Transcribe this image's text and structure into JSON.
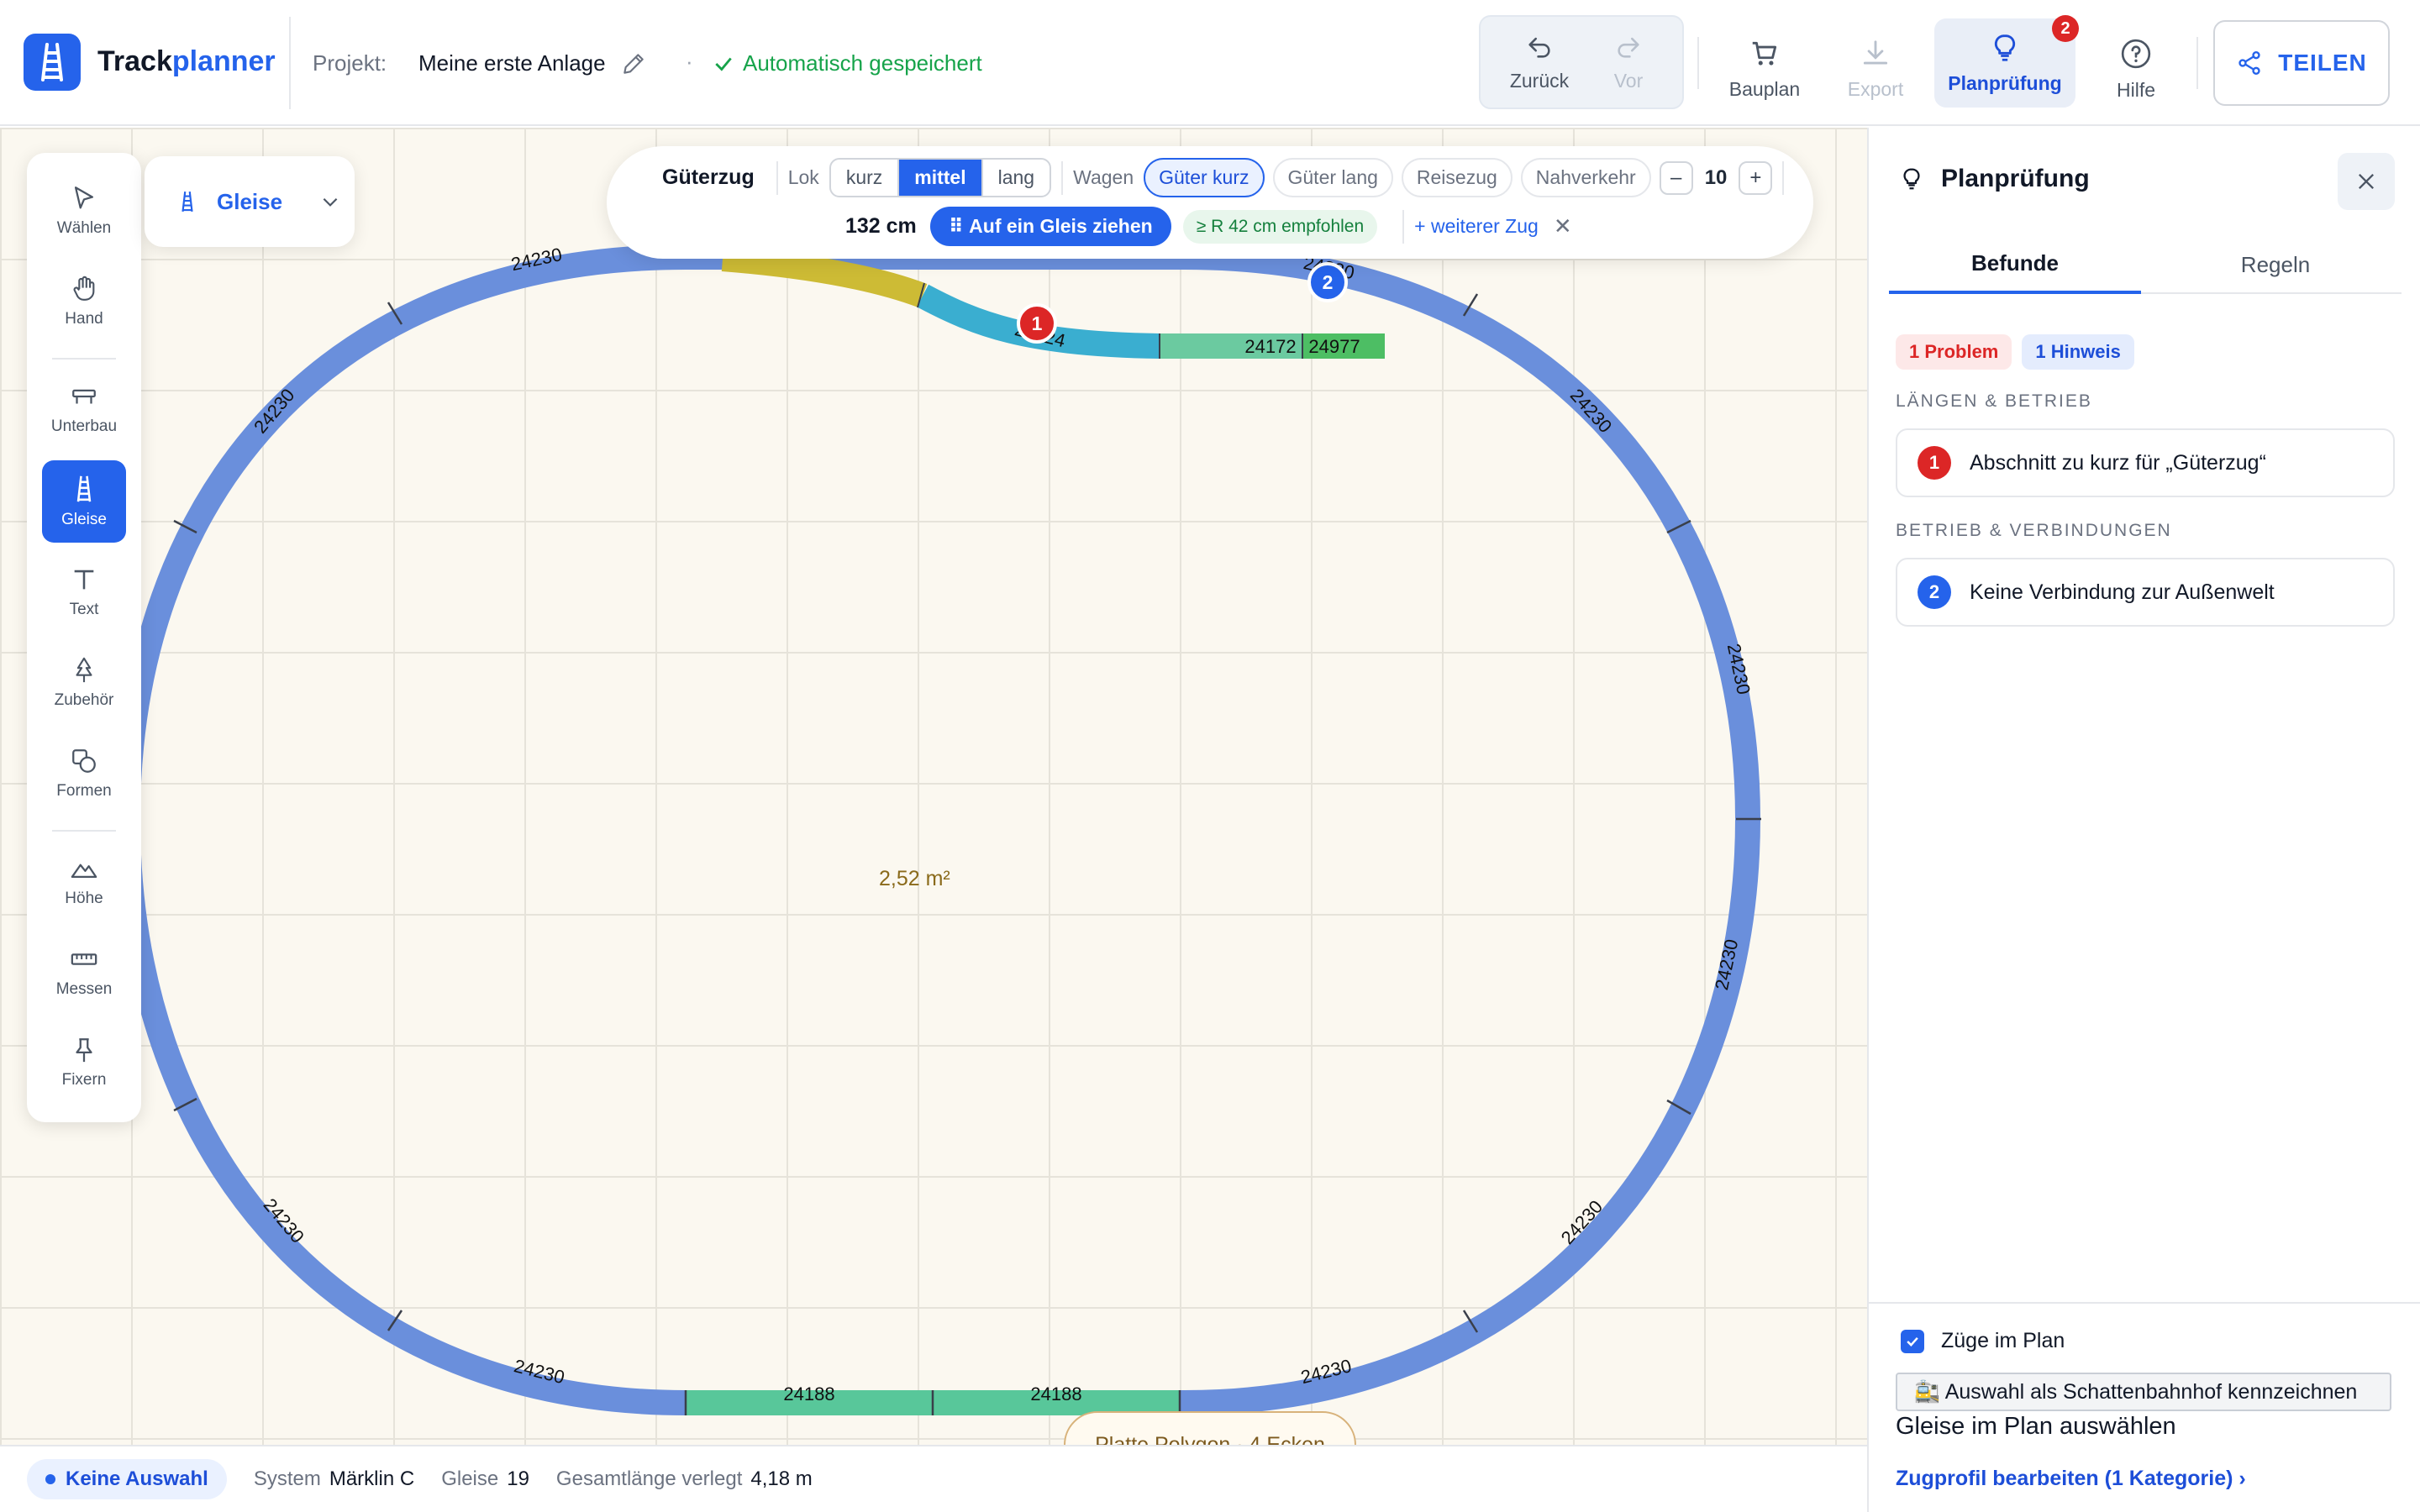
{
  "app": {
    "name_part1": "Track",
    "name_part2": "planner"
  },
  "project": {
    "label": "Projekt:",
    "name": "Meine erste Anlage",
    "separator": "·",
    "save_status": "Automatisch gespeichert"
  },
  "header_buttons": {
    "undo": "Zurück",
    "redo": "Vor",
    "bauplan": "Bauplan",
    "export": "Export",
    "planpruefung": "Planprüfung",
    "planpruefung_badge": "2",
    "hilfe": "Hilfe",
    "share": "TEILEN"
  },
  "tools": {
    "waehlen": "Wählen",
    "hand": "Hand",
    "unterbau": "Unterbau",
    "gleise": "Gleise",
    "text": "Text",
    "zubehoer": "Zubehör",
    "formen": "Formen",
    "hoehe": "Höhe",
    "messen": "Messen",
    "fixern": "Fixern"
  },
  "layer_dropdown": "Gleise",
  "train_bar": {
    "title": "Güterzug",
    "lok_label": "Lok",
    "lok_options": [
      "kurz",
      "mittel",
      "lang"
    ],
    "lok_selected": "mittel",
    "wagen_label": "Wagen",
    "wagen_options": [
      "Güter kurz",
      "Güter lang",
      "Reisezug",
      "Nahverkehr"
    ],
    "wagen_selected": "Güter kurz",
    "minus": "–",
    "count": "10",
    "plus": "+",
    "length": "132 cm",
    "drag_button": "⠿ Auf ein Gleis ziehen",
    "recommendation": "≥ R 42 cm empfohlen",
    "more_train": "+ weiterer Zug",
    "close": "✕"
  },
  "canvas": {
    "area_label": "2,52 m²",
    "plate_label": "Platte Polygon · 4 Ecken",
    "track_labels": {
      "curve": "24230",
      "straight_long": "24188",
      "straight_a": "24172",
      "straight_b": "24977",
      "s_curve": "24224"
    },
    "markers": [
      "1",
      "2"
    ]
  },
  "status_bar": {
    "selection": "Keine Auswahl",
    "system_label": "System",
    "system_value": "Märklin C",
    "tracks_label": "Gleise",
    "tracks_value": "19",
    "length_label": "Gesamtlänge verlegt",
    "length_value": "4,18 m"
  },
  "panel": {
    "title": "Planprüfung",
    "tabs": [
      "Befunde",
      "Regeln"
    ],
    "problem_count": "1 Problem",
    "hint_count": "1 Hinweis",
    "sections": [
      {
        "title": "LÄNGEN & BETRIEB",
        "finding_num": "1",
        "finding_text": "Abschnitt zu kurz für „Güterzug“"
      },
      {
        "title": "BETRIEB & VERBINDUNGEN",
        "finding_num": "2",
        "finding_text": "Keine Verbindung zur Außenwelt"
      }
    ],
    "trains_in_plan": "Züge im Plan",
    "shadow_button": "🚉 Auswahl als Schattenbahnhof kennzeichnen",
    "select_tracks": "Gleise im Plan auswählen",
    "profile_link": "Zugprofil bearbeiten (1 Kategorie) ›"
  },
  "colors": {
    "accent": "#2563eb",
    "track_curve": "#6a8fdc",
    "track_straight": "#58c79a",
    "track_short": "#3aaed0",
    "track_yellow": "#cdbb35",
    "problem": "#dc2626"
  }
}
